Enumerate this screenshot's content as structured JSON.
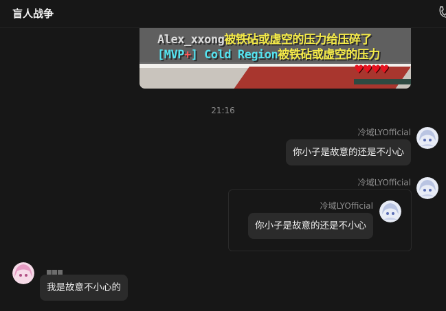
{
  "header": {
    "title": "盲人战争",
    "call_icon": "phone-icon"
  },
  "image_message": {
    "lines": [
      {
        "segments": [
          {
            "text": "Alex_xxong",
            "color": "gray"
          },
          {
            "text": "被铁砧或虚空的压力给压碎了",
            "color": "yellow"
          }
        ]
      },
      {
        "segments": [
          {
            "text": "[MVP",
            "color": "cyan"
          },
          {
            "text": "+",
            "color": "red"
          },
          {
            "text": "] Cold Region",
            "color": "cyan"
          },
          {
            "text": "被铁砧或虚空的压力",
            "color": "yellow"
          }
        ]
      }
    ],
    "hearts": "♥♥♥♥"
  },
  "timestamp": "21:16",
  "messages": [
    {
      "sender": "冷域LYOfficial",
      "text": "你小子是故意的还是不小心"
    },
    {
      "sender": "冷域LYOfficial",
      "forward": {
        "sender": "冷域LYOfficial",
        "text": "你小子是故意的还是不小心"
      }
    },
    {
      "sender": "",
      "text": "我是故意不小心的"
    }
  ],
  "colors": {
    "background": "#171717",
    "bubble": "#2b2b2b",
    "game_yellow": "#f4ea48",
    "game_cyan": "#55e3f0"
  }
}
